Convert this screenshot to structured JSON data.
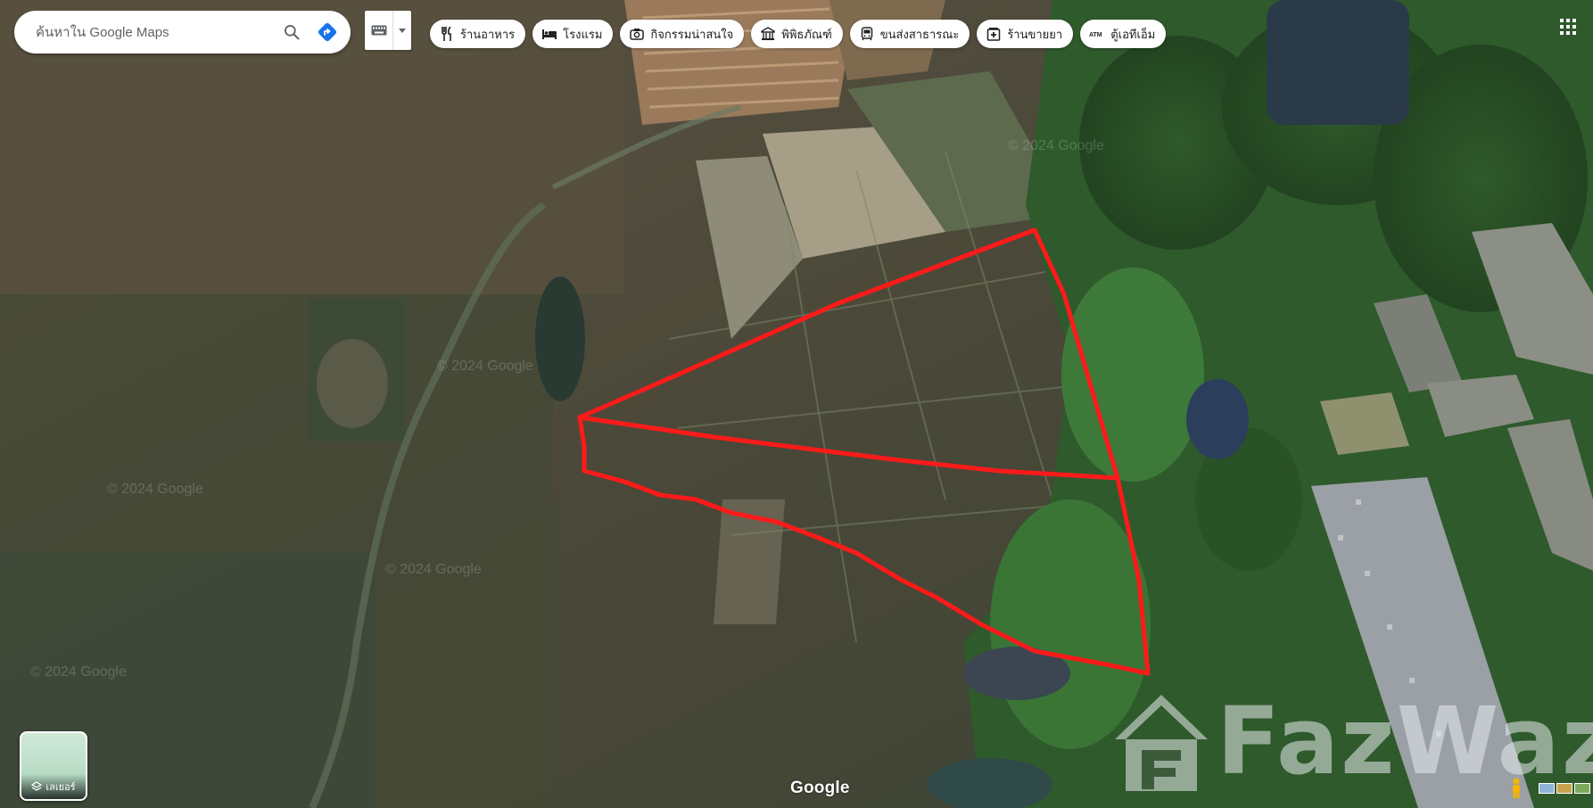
{
  "search": {
    "placeholder": "ค้นหาใน Google Maps"
  },
  "icons": {
    "search": "search-icon",
    "directions": "directions-icon",
    "keyboard": "keyboard-icon",
    "dropdown": "dropdown-arrow-icon",
    "apps": "apps-grid-icon",
    "layers": "layers-icon",
    "pegman": "pegman-icon"
  },
  "chips": [
    {
      "label": "ร้านอาหาร",
      "icon": "restaurant-icon"
    },
    {
      "label": "โรงแรม",
      "icon": "hotel-icon"
    },
    {
      "label": "กิจกรรมน่าสนใจ",
      "icon": "camera-icon"
    },
    {
      "label": "พิพิธภัณฑ์",
      "icon": "museum-icon"
    },
    {
      "label": "ขนส่งสาธารณะ",
      "icon": "transit-icon"
    },
    {
      "label": "ร้านขายยา",
      "icon": "pharmacy-icon"
    },
    {
      "label": "ตู้เอทีเอ็ม",
      "icon": "atm-icon"
    }
  ],
  "layers": {
    "label": "เลเยอร์"
  },
  "map": {
    "attribution": "Google",
    "watermarks": [
      "© 2024 Google",
      "© 2024 Google",
      "© 2024 Google",
      "© 2024 Google",
      "© 2024 Google"
    ],
    "overlay": "FazWaz",
    "boundary_color": "#ff1a1a"
  },
  "colors": {
    "chip_bg": "#ffffff",
    "directions_blue": "#1a73e8",
    "boundary_red": "#ff1a1a"
  }
}
